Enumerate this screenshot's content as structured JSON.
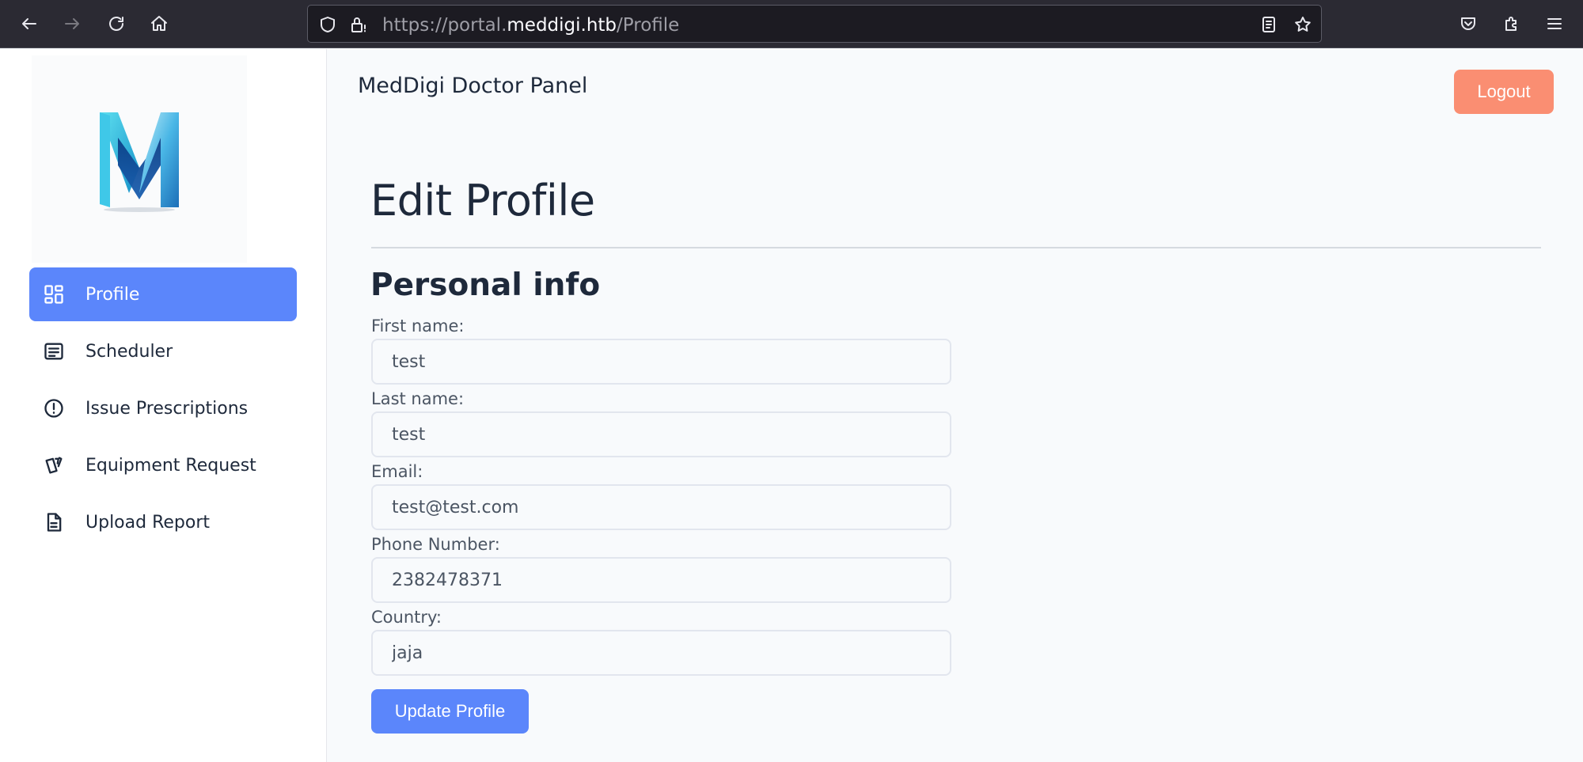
{
  "browser": {
    "url_prefix": "https://portal.",
    "url_domain": "meddigi.htb",
    "url_path": "/Profile"
  },
  "sidebar": {
    "items": [
      {
        "label": "Profile",
        "icon": "dashboard-icon",
        "active": true
      },
      {
        "label": "Scheduler",
        "icon": "list-icon",
        "active": false
      },
      {
        "label": "Issue Prescriptions",
        "icon": "alert-circle-icon",
        "active": false
      },
      {
        "label": "Equipment Request",
        "icon": "cards-icon",
        "active": false
      },
      {
        "label": "Upload Report",
        "icon": "document-icon",
        "active": false
      }
    ]
  },
  "header": {
    "panel_title": "MedDigi Doctor Panel",
    "logout_label": "Logout"
  },
  "main": {
    "page_title": "Edit Profile",
    "section_title": "Personal info",
    "fields": [
      {
        "label": "First name:",
        "value": "test"
      },
      {
        "label": "Last name:",
        "value": "test"
      },
      {
        "label": "Email:",
        "value": "test@test.com"
      },
      {
        "label": "Phone Number:",
        "value": "2382478371"
      },
      {
        "label": "Country:",
        "value": "jaja"
      }
    ],
    "submit_label": "Update Profile"
  },
  "colors": {
    "accent": "#5b86fb",
    "logout": "#fa8e72",
    "browser_chrome": "#2b2a33"
  }
}
